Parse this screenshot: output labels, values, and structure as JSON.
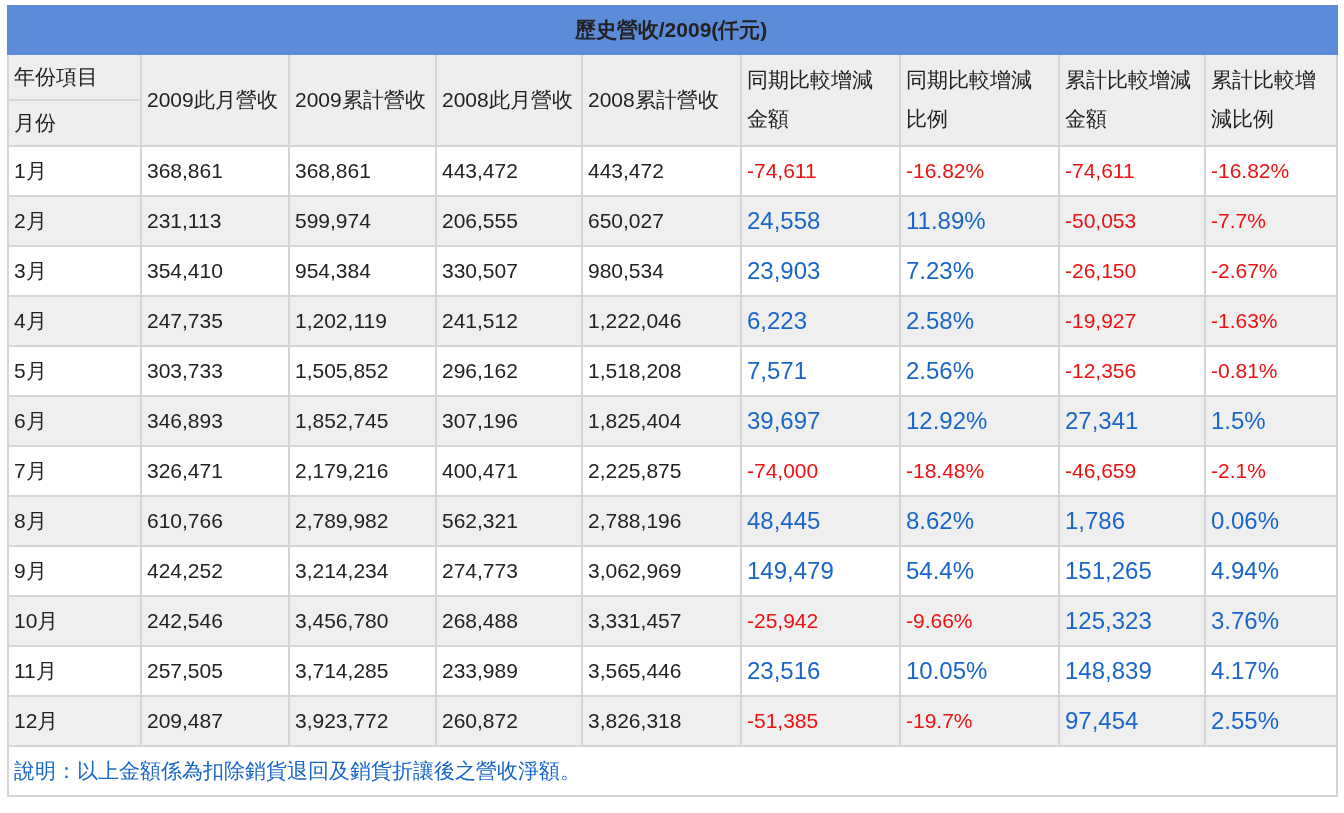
{
  "title": "歷史營收/2009(仟元)",
  "header": {
    "corner_top": "年份項目",
    "corner_bottom": "月份",
    "columns": [
      "2009此月營收",
      "2009累計營收",
      "2008此月營收",
      "2008累計營收",
      "同期比較增減金額",
      "同期比較增減比例",
      "累計比較增減金額",
      "累計比較增減比例"
    ]
  },
  "rows": [
    {
      "month": "1月",
      "cells": [
        {
          "text": "368,861",
          "kind": "plain"
        },
        {
          "text": "368,861",
          "kind": "plain"
        },
        {
          "text": "443,472",
          "kind": "plain"
        },
        {
          "text": "443,472",
          "kind": "plain"
        },
        {
          "text": "-74,611",
          "kind": "decrease"
        },
        {
          "text": "-16.82%",
          "kind": "decrease"
        },
        {
          "text": "-74,611",
          "kind": "decrease"
        },
        {
          "text": "-16.82%",
          "kind": "decrease"
        }
      ]
    },
    {
      "month": "2月",
      "cells": [
        {
          "text": "231,113",
          "kind": "plain"
        },
        {
          "text": "599,974",
          "kind": "plain"
        },
        {
          "text": "206,555",
          "kind": "plain"
        },
        {
          "text": "650,027",
          "kind": "plain"
        },
        {
          "text": "24,558",
          "kind": "increase"
        },
        {
          "text": "11.89%",
          "kind": "increase"
        },
        {
          "text": "-50,053",
          "kind": "decrease"
        },
        {
          "text": "-7.7%",
          "kind": "decrease"
        }
      ]
    },
    {
      "month": "3月",
      "cells": [
        {
          "text": "354,410",
          "kind": "plain"
        },
        {
          "text": "954,384",
          "kind": "plain"
        },
        {
          "text": "330,507",
          "kind": "plain"
        },
        {
          "text": "980,534",
          "kind": "plain"
        },
        {
          "text": "23,903",
          "kind": "increase"
        },
        {
          "text": "7.23%",
          "kind": "increase"
        },
        {
          "text": "-26,150",
          "kind": "decrease"
        },
        {
          "text": "-2.67%",
          "kind": "decrease"
        }
      ]
    },
    {
      "month": "4月",
      "cells": [
        {
          "text": "247,735",
          "kind": "plain"
        },
        {
          "text": "1,202,119",
          "kind": "plain"
        },
        {
          "text": "241,512",
          "kind": "plain"
        },
        {
          "text": "1,222,046",
          "kind": "plain"
        },
        {
          "text": "6,223",
          "kind": "increase"
        },
        {
          "text": "2.58%",
          "kind": "increase"
        },
        {
          "text": "-19,927",
          "kind": "decrease"
        },
        {
          "text": "-1.63%",
          "kind": "decrease"
        }
      ]
    },
    {
      "month": "5月",
      "cells": [
        {
          "text": "303,733",
          "kind": "plain"
        },
        {
          "text": "1,505,852",
          "kind": "plain"
        },
        {
          "text": "296,162",
          "kind": "plain"
        },
        {
          "text": "1,518,208",
          "kind": "plain"
        },
        {
          "text": "7,571",
          "kind": "increase"
        },
        {
          "text": "2.56%",
          "kind": "increase"
        },
        {
          "text": "-12,356",
          "kind": "decrease"
        },
        {
          "text": "-0.81%",
          "kind": "decrease"
        }
      ]
    },
    {
      "month": "6月",
      "cells": [
        {
          "text": "346,893",
          "kind": "plain"
        },
        {
          "text": "1,852,745",
          "kind": "plain"
        },
        {
          "text": "307,196",
          "kind": "plain"
        },
        {
          "text": "1,825,404",
          "kind": "plain"
        },
        {
          "text": "39,697",
          "kind": "increase"
        },
        {
          "text": "12.92%",
          "kind": "increase"
        },
        {
          "text": "27,341",
          "kind": "increase"
        },
        {
          "text": "1.5%",
          "kind": "increase"
        }
      ]
    },
    {
      "month": "7月",
      "cells": [
        {
          "text": "326,471",
          "kind": "plain"
        },
        {
          "text": "2,179,216",
          "kind": "plain"
        },
        {
          "text": "400,471",
          "kind": "plain"
        },
        {
          "text": "2,225,875",
          "kind": "plain"
        },
        {
          "text": "-74,000",
          "kind": "decrease"
        },
        {
          "text": "-18.48%",
          "kind": "decrease"
        },
        {
          "text": "-46,659",
          "kind": "decrease"
        },
        {
          "text": "-2.1%",
          "kind": "decrease"
        }
      ]
    },
    {
      "month": "8月",
      "cells": [
        {
          "text": "610,766",
          "kind": "plain"
        },
        {
          "text": "2,789,982",
          "kind": "plain"
        },
        {
          "text": "562,321",
          "kind": "plain"
        },
        {
          "text": "2,788,196",
          "kind": "plain"
        },
        {
          "text": "48,445",
          "kind": "increase"
        },
        {
          "text": "8.62%",
          "kind": "increase"
        },
        {
          "text": "1,786",
          "kind": "increase"
        },
        {
          "text": "0.06%",
          "kind": "increase"
        }
      ]
    },
    {
      "month": "9月",
      "cells": [
        {
          "text": "424,252",
          "kind": "plain"
        },
        {
          "text": "3,214,234",
          "kind": "plain"
        },
        {
          "text": "274,773",
          "kind": "plain"
        },
        {
          "text": "3,062,969",
          "kind": "plain"
        },
        {
          "text": "149,479",
          "kind": "increase"
        },
        {
          "text": "54.4%",
          "kind": "increase"
        },
        {
          "text": "151,265",
          "kind": "increase"
        },
        {
          "text": "4.94%",
          "kind": "increase"
        }
      ]
    },
    {
      "month": "10月",
      "cells": [
        {
          "text": "242,546",
          "kind": "plain"
        },
        {
          "text": "3,456,780",
          "kind": "plain"
        },
        {
          "text": "268,488",
          "kind": "plain"
        },
        {
          "text": "3,331,457",
          "kind": "plain"
        },
        {
          "text": "-25,942",
          "kind": "decrease"
        },
        {
          "text": "-9.66%",
          "kind": "decrease"
        },
        {
          "text": "125,323",
          "kind": "increase"
        },
        {
          "text": "3.76%",
          "kind": "increase"
        }
      ]
    },
    {
      "month": "11月",
      "cells": [
        {
          "text": "257,505",
          "kind": "plain"
        },
        {
          "text": "3,714,285",
          "kind": "plain"
        },
        {
          "text": "233,989",
          "kind": "plain"
        },
        {
          "text": "3,565,446",
          "kind": "plain"
        },
        {
          "text": "23,516",
          "kind": "increase"
        },
        {
          "text": "10.05%",
          "kind": "increase"
        },
        {
          "text": "148,839",
          "kind": "increase"
        },
        {
          "text": "4.17%",
          "kind": "increase"
        }
      ]
    },
    {
      "month": "12月",
      "cells": [
        {
          "text": "209,487",
          "kind": "plain"
        },
        {
          "text": "3,923,772",
          "kind": "plain"
        },
        {
          "text": "260,872",
          "kind": "plain"
        },
        {
          "text": "3,826,318",
          "kind": "plain"
        },
        {
          "text": "-51,385",
          "kind": "decrease"
        },
        {
          "text": "-19.7%",
          "kind": "decrease"
        },
        {
          "text": "97,454",
          "kind": "increase"
        },
        {
          "text": "2.55%",
          "kind": "increase"
        }
      ]
    }
  ],
  "note": "說明：以上金額係為扣除銷貨退回及銷貨折讓後之營收淨額。"
}
